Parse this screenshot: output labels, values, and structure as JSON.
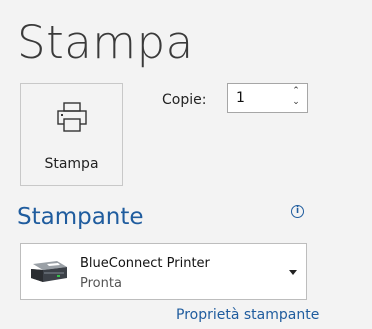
{
  "header": {
    "title": "Stampa"
  },
  "print_button": {
    "label": "Stampa",
    "icon": "printer-icon"
  },
  "copies": {
    "label": "Copie:",
    "value": "1"
  },
  "printer_section": {
    "title": "Stampante",
    "info_icon": "info-icon",
    "selected_printer": {
      "name": "BlueConnect Printer",
      "status": "Pronta",
      "icon": "printer-device-icon"
    },
    "properties_link": "Proprietà stampante"
  },
  "colors": {
    "accent": "#1f5c9e",
    "background": "#f3f3f3"
  }
}
